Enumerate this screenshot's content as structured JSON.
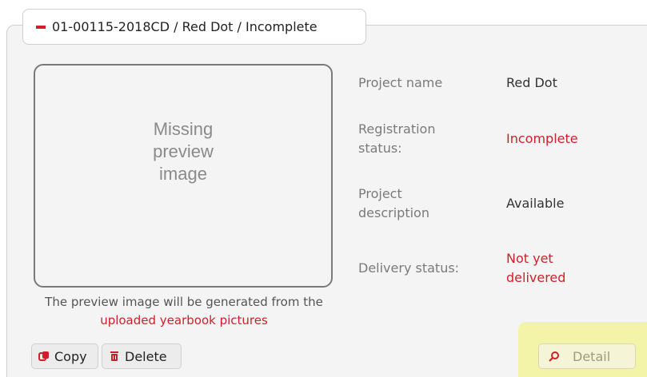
{
  "project": {
    "header_title": "01-00115-2018CD / Red Dot / Incomplete",
    "preview": {
      "missing_text": "Missing preview image",
      "caption_prefix": "The preview image will be generated from the",
      "caption_link": "uploaded yearbook pictures"
    },
    "fields": [
      {
        "label": "Project name",
        "value": "Red Dot"
      },
      {
        "label": "Registration status:",
        "value": "Incomplete"
      },
      {
        "label": "Project description",
        "value": "Available"
      },
      {
        "label": "Delivery status:",
        "value": "Not yet delivered"
      }
    ],
    "actions": {
      "copy_label": "Copy",
      "delete_label": "Delete",
      "detail_label": "Detail"
    },
    "colors": {
      "accent": "#d01f2b",
      "highlight": "#f3f4a8"
    },
    "icons": {
      "header": "minus-icon",
      "copy": "copy-icon",
      "delete": "trash-icon",
      "detail": "search-icon"
    }
  }
}
